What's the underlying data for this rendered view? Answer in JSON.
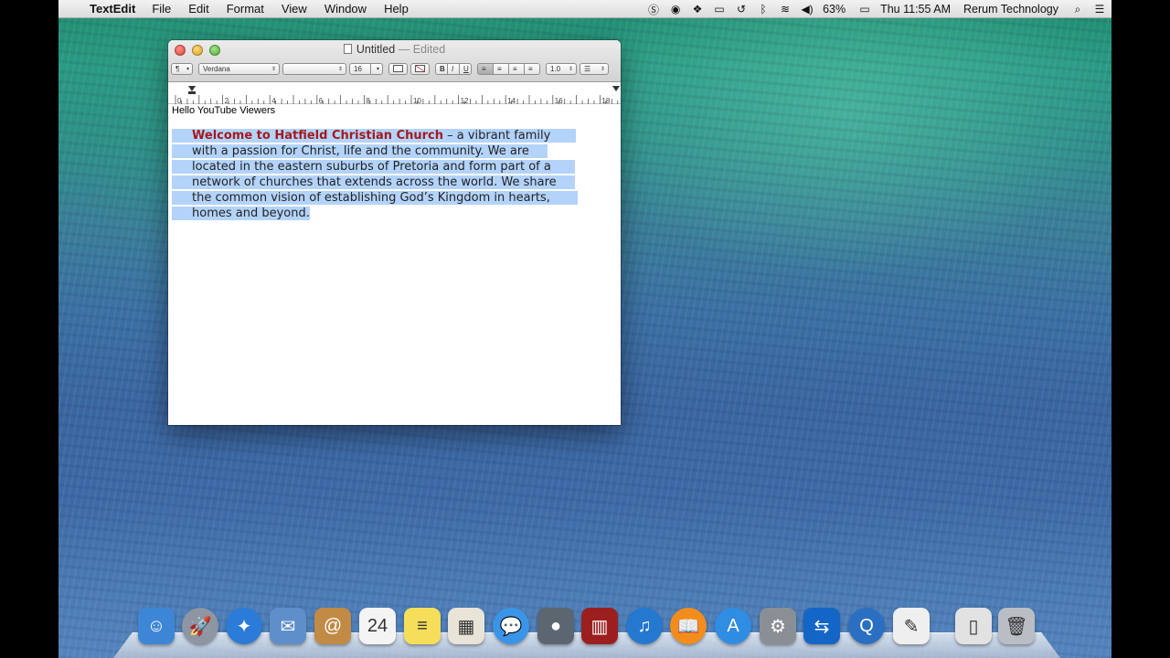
{
  "menubar": {
    "apple": "",
    "app_name": "TextEdit",
    "menus": [
      "File",
      "Edit",
      "Format",
      "View",
      "Window",
      "Help"
    ],
    "status_icons": [
      "skype-icon",
      "record-icon",
      "dropbox-icon",
      "screen-mirror-icon",
      "time-machine-icon",
      "bluetooth-icon",
      "wifi-icon",
      "volume-icon"
    ],
    "battery": "63%",
    "clock": "Thu 11:55 AM",
    "user": "Rerum Technology"
  },
  "window": {
    "title": "Untitled",
    "separator": "—",
    "edited": "Edited",
    "toolbar": {
      "paragraph_style": "¶",
      "font_family": "Verdana",
      "font_style": "",
      "font_size": "16",
      "bold": "B",
      "italic": "I",
      "underline": "U",
      "line_spacing": "1.0",
      "list": "☰"
    },
    "ruler_labels": [
      "0",
      "2",
      "4",
      "6",
      "8",
      "10",
      "12",
      "14",
      "16",
      "18"
    ],
    "text": {
      "line0": "Hello YouTube Viewers",
      "heading": "Welcome to Hatfield Christian Church",
      "lines": [
        " – a vibrant family",
        "with a passion for Christ, life and the community. We are",
        "located in the eastern suburbs of Pretoria and form part of a",
        "network of churches that extends across the world. We share",
        "the common vision of establishing God’s Kingdom in hearts,",
        "homes and beyond."
      ]
    }
  },
  "dock": {
    "apps": [
      {
        "name": "finder-icon",
        "glyph": "☺",
        "color": "#3d86d6"
      },
      {
        "name": "launchpad-icon",
        "glyph": "🚀",
        "color": "#8e96a3"
      },
      {
        "name": "safari-icon",
        "glyph": "✦",
        "color": "#2b7bd8"
      },
      {
        "name": "mail-icon",
        "glyph": "✉",
        "color": "#5f8fc9"
      },
      {
        "name": "contacts-icon",
        "glyph": "@",
        "color": "#c18a45"
      },
      {
        "name": "calendar-icon",
        "glyph": "24",
        "color": "#f4f4f4"
      },
      {
        "name": "notes-icon",
        "glyph": "≡",
        "color": "#f5de5a"
      },
      {
        "name": "preview-icon",
        "glyph": "▦",
        "color": "#e9e4d8"
      },
      {
        "name": "messages-icon",
        "glyph": "💬",
        "color": "#3a95e8"
      },
      {
        "name": "facetime-icon",
        "glyph": "●",
        "color": "#5c6670"
      },
      {
        "name": "photo-booth-icon",
        "glyph": "▥",
        "color": "#9c1f1f"
      },
      {
        "name": "itunes-icon",
        "glyph": "♫",
        "color": "#2478cf"
      },
      {
        "name": "ibooks-icon",
        "glyph": "📖",
        "color": "#f28d1c"
      },
      {
        "name": "app-store-icon",
        "glyph": "A",
        "color": "#2f8de4"
      },
      {
        "name": "system-preferences-icon",
        "glyph": "⚙",
        "color": "#8a8f96"
      },
      {
        "name": "teamviewer-icon",
        "glyph": "⇆",
        "color": "#1466c6"
      },
      {
        "name": "quicktime-icon",
        "glyph": "Q",
        "color": "#2b6fc2"
      },
      {
        "name": "textedit-icon",
        "glyph": "✎",
        "color": "#efefef"
      },
      {
        "name": "document-icon",
        "glyph": "▯",
        "color": "#e2e2e2"
      },
      {
        "name": "trash-icon",
        "glyph": "🗑",
        "color": "#b9bec4"
      }
    ]
  }
}
